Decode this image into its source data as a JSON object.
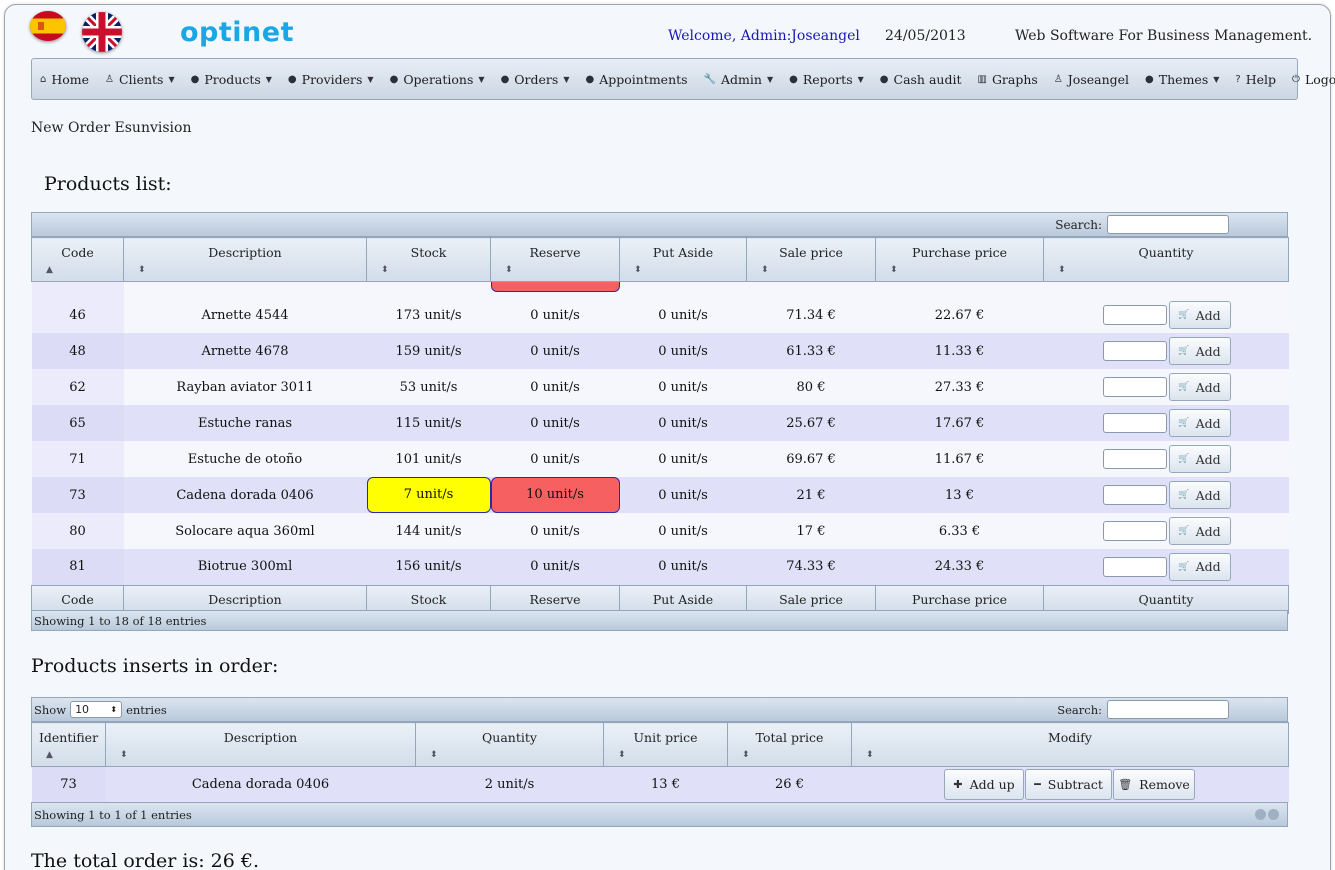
{
  "header": {
    "logo": "optinet",
    "welcome": "Welcome, Admin:Joseangel",
    "date": "24/05/2013",
    "slogan": "Web Software For Business Management."
  },
  "menu": [
    {
      "icon": "home-icon",
      "glyph": "⌂",
      "label": "Home",
      "dropdown": false
    },
    {
      "icon": "user-icon",
      "glyph": "♙",
      "label": "Clients",
      "dropdown": true
    },
    {
      "icon": "bullet-icon",
      "glyph": "●",
      "label": "Products",
      "dropdown": true
    },
    {
      "icon": "bullet-icon",
      "glyph": "●",
      "label": "Providers",
      "dropdown": true
    },
    {
      "icon": "bullet-icon",
      "glyph": "●",
      "label": "Operations",
      "dropdown": true
    },
    {
      "icon": "bullet-icon",
      "glyph": "●",
      "label": "Orders",
      "dropdown": true
    },
    {
      "icon": "bullet-icon",
      "glyph": "●",
      "label": "Appointments",
      "dropdown": false
    },
    {
      "icon": "wrench-icon",
      "glyph": "🔧",
      "label": "Admin",
      "dropdown": true
    },
    {
      "icon": "bullet-icon",
      "glyph": "●",
      "label": "Reports",
      "dropdown": true
    },
    {
      "icon": "bullet-icon",
      "glyph": "●",
      "label": "Cash audit",
      "dropdown": false
    },
    {
      "icon": "graph-icon",
      "glyph": "▥",
      "label": "Graphs",
      "dropdown": false
    },
    {
      "icon": "user-icon",
      "glyph": "♙",
      "label": "Joseangel",
      "dropdown": false
    },
    {
      "icon": "bullet-icon",
      "glyph": "●",
      "label": "Themes",
      "dropdown": true
    },
    {
      "icon": "help-icon",
      "glyph": "?",
      "label": "Help",
      "dropdown": false
    },
    {
      "icon": "power-icon",
      "glyph": "⏻",
      "label": "Logout",
      "dropdown": false
    }
  ],
  "page": {
    "breadcrumb": "New Order Esunvision",
    "products_title": "Products list:",
    "inserts_title": "Products inserts in order:",
    "total": "The total order is: 26 €."
  },
  "products": {
    "search_label": "Search:",
    "columns": [
      "Code",
      "Description",
      "Stock",
      "Reserve",
      "Put Aside",
      "Sale price",
      "Purchase price",
      "Quantity"
    ],
    "add_label": "Add",
    "rows": [
      {
        "code": "46",
        "description": "Arnette 4544",
        "stock": "173 unit/s",
        "reserve": "0 unit/s",
        "aside": "0 unit/s",
        "sale": "71.34 €",
        "purchase": "22.67 €"
      },
      {
        "code": "48",
        "description": "Arnette 4678",
        "stock": "159 unit/s",
        "reserve": "0 unit/s",
        "aside": "0 unit/s",
        "sale": "61.33 €",
        "purchase": "11.33 €"
      },
      {
        "code": "62",
        "description": "Rayban aviator 3011",
        "stock": "53 unit/s",
        "reserve": "0 unit/s",
        "aside": "0 unit/s",
        "sale": "80 €",
        "purchase": "27.33 €"
      },
      {
        "code": "65",
        "description": "Estuche ranas",
        "stock": "115 unit/s",
        "reserve": "0 unit/s",
        "aside": "0 unit/s",
        "sale": "25.67 €",
        "purchase": "17.67 €"
      },
      {
        "code": "71",
        "description": "Estuche de otoño",
        "stock": "101 unit/s",
        "reserve": "0 unit/s",
        "aside": "0 unit/s",
        "sale": "69.67 €",
        "purchase": "11.67 €"
      },
      {
        "code": "73",
        "description": "Cadena dorada 0406",
        "stock": "7 unit/s",
        "reserve": "10 unit/s",
        "aside": "0 unit/s",
        "sale": "21 €",
        "purchase": "13 €",
        "highlight": true
      },
      {
        "code": "80",
        "description": "Solocare aqua 360ml",
        "stock": "144 unit/s",
        "reserve": "0 unit/s",
        "aside": "0 unit/s",
        "sale": "17 €",
        "purchase": "6.33 €"
      },
      {
        "code": "81",
        "description": "Biotrue 300ml",
        "stock": "156 unit/s",
        "reserve": "0 unit/s",
        "aside": "0 unit/s",
        "sale": "74.33 €",
        "purchase": "24.33 €"
      }
    ],
    "info": "Showing 1 to 18 of 18 entries"
  },
  "order": {
    "show_label": "Show",
    "show_value": "10",
    "entries_label": "entries",
    "search_label": "Search:",
    "columns": [
      "Identifier",
      "Description",
      "Quantity",
      "Unit price",
      "Total price",
      "Modify"
    ],
    "rows": [
      {
        "id": "73",
        "description": "Cadena dorada 0406",
        "quantity": "2 unit/s",
        "unit": "13 €",
        "total": "26 €"
      }
    ],
    "buttons": {
      "add_up": "Add up",
      "subtract": "Subtract",
      "remove": "Remove"
    },
    "info": "Showing 1 to 1 of 1 entries"
  },
  "colors": {
    "stock_warning": "#ffff00",
    "reserve_alert": "#f66060",
    "logo": "#1ba7e6",
    "welcome": "#1818b6"
  }
}
